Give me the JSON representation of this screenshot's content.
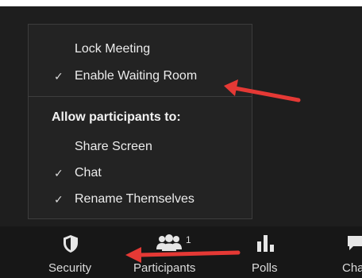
{
  "security_menu": {
    "items": [
      {
        "label": "Lock Meeting",
        "checked": false
      },
      {
        "label": "Enable Waiting Room",
        "checked": true
      }
    ],
    "section_heading": "Allow participants to:",
    "permissions": [
      {
        "label": "Share Screen",
        "checked": false
      },
      {
        "label": "Chat",
        "checked": true
      },
      {
        "label": "Rename Themselves",
        "checked": true
      }
    ],
    "check_glyph": "✓"
  },
  "toolbar": {
    "security_label": "Security",
    "participants_label": "Participants",
    "participants_count": "1",
    "polls_label": "Polls",
    "chat_label": "Cha"
  },
  "annotations": {
    "arrow_color": "#e53935"
  },
  "icons": {
    "security": "shield-icon",
    "participants": "people-icon",
    "polls": "bar-chart-icon",
    "chat": "speech-bubble-icon"
  }
}
